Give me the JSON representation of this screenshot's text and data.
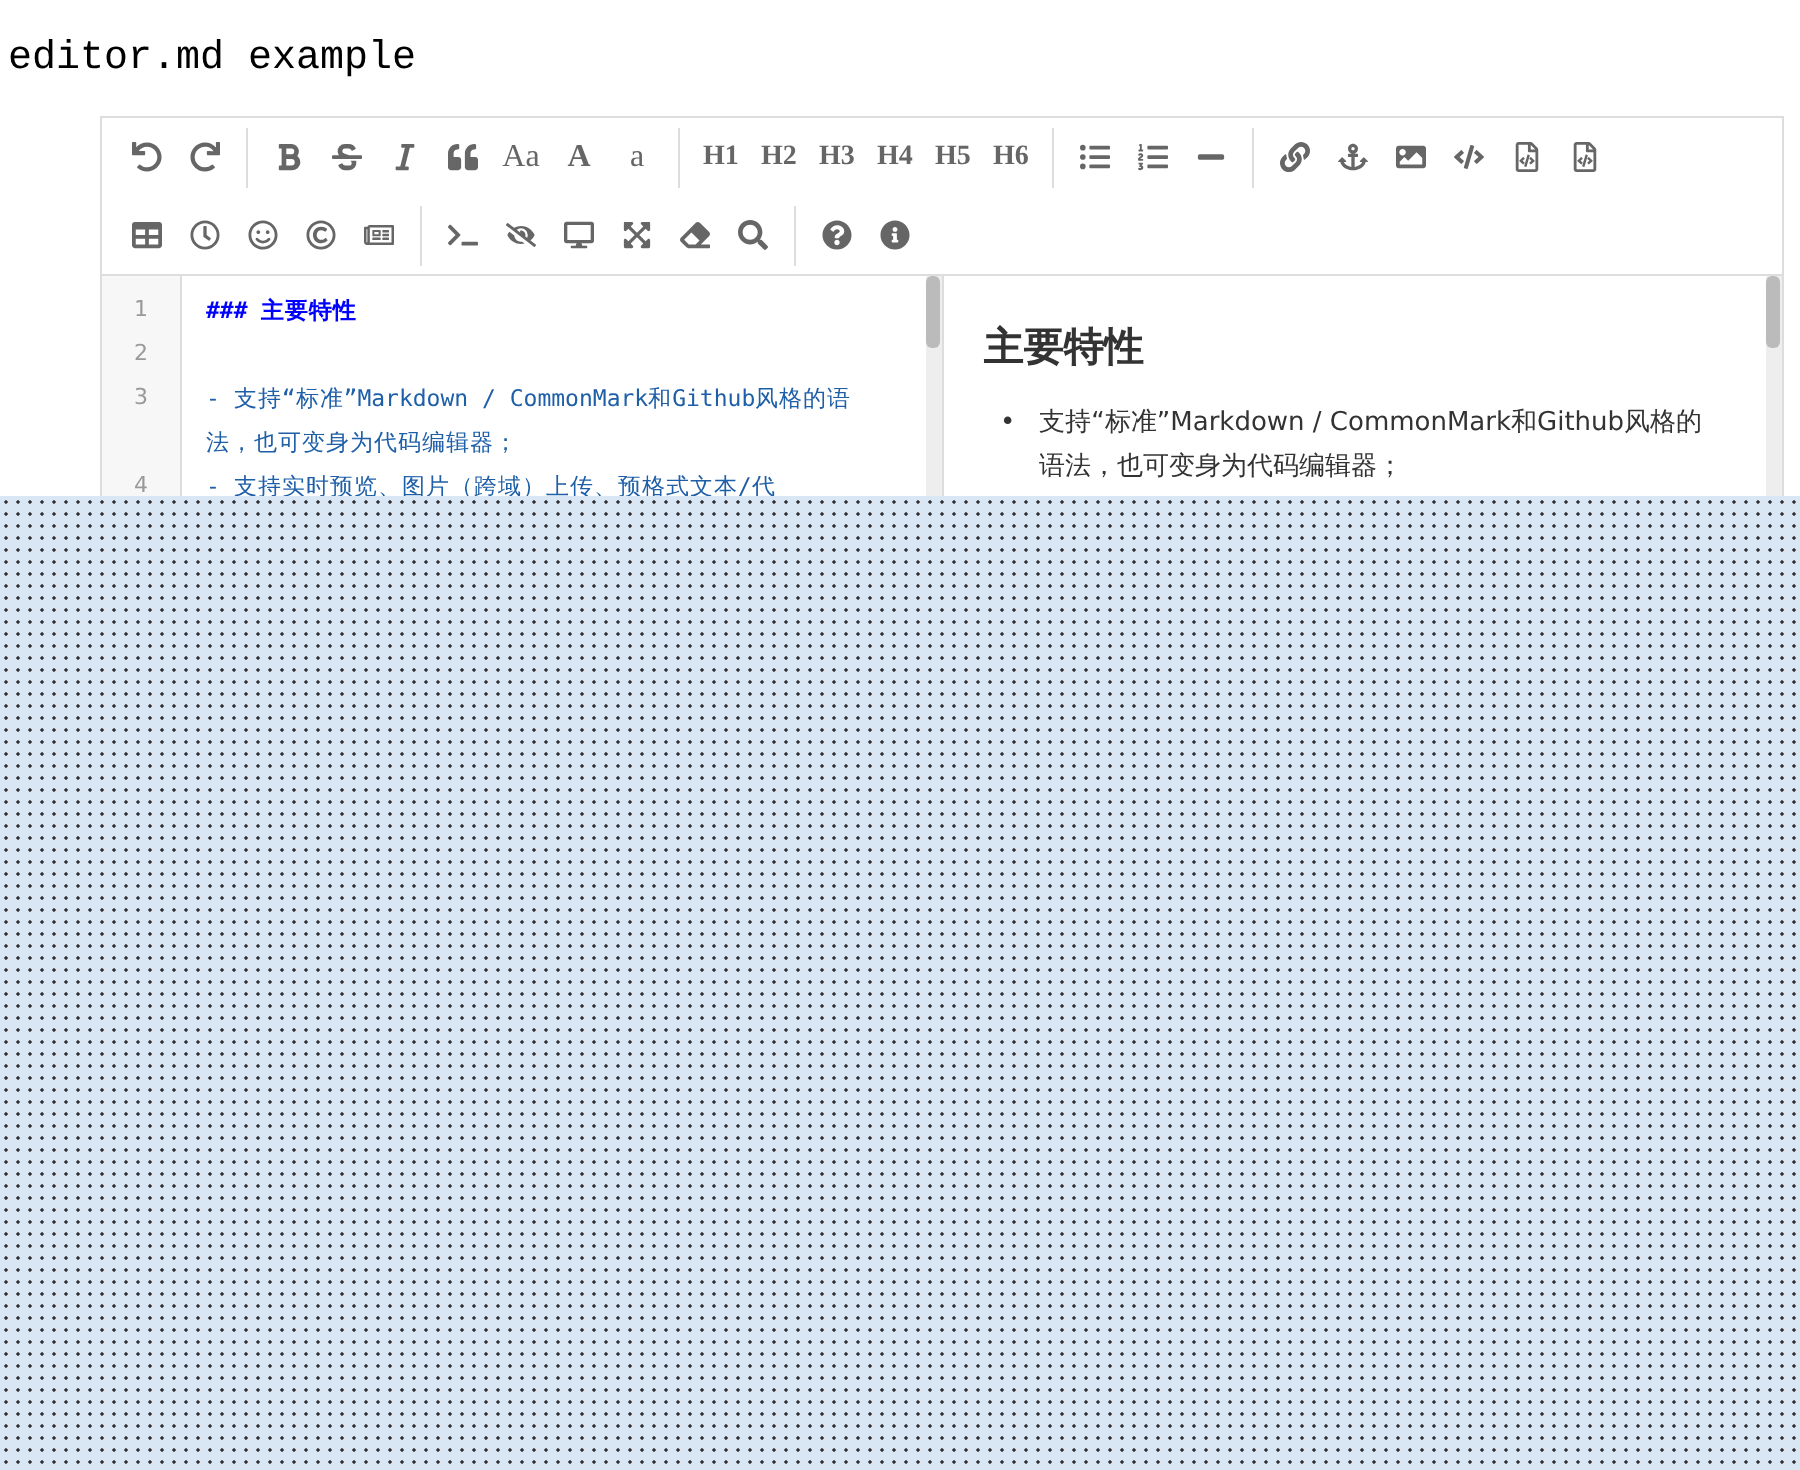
{
  "page_title": "editor.md example",
  "toolbar": {
    "rows": [
      [
        [
          {
            "kind": "icon"
          },
          {
            "kind": "icon"
          }
        ],
        [
          {
            "kind": "icon"
          },
          {
            "kind": "icon"
          },
          {
            "kind": "icon"
          },
          {
            "kind": "icon"
          },
          {
            "kind": "text",
            "label": "Aa"
          },
          {
            "kind": "bold_text",
            "label": "A"
          },
          {
            "kind": "text",
            "label": "a"
          }
        ],
        [
          {
            "kind": "text",
            "label": "H1"
          },
          {
            "kind": "text",
            "label": "H2"
          },
          {
            "kind": "text",
            "label": "H3"
          },
          {
            "kind": "text",
            "label": "H4"
          },
          {
            "kind": "text",
            "label": "H5"
          },
          {
            "kind": "text",
            "label": "H6"
          }
        ],
        [
          {
            "kind": "icon"
          },
          {
            "kind": "icon"
          },
          {
            "kind": "icon"
          }
        ],
        [
          {
            "kind": "icon"
          },
          {
            "kind": "icon"
          },
          {
            "kind": "icon"
          },
          {
            "kind": "icon"
          },
          {
            "kind": "icon"
          },
          {
            "kind": "icon"
          }
        ]
      ],
      [
        [
          {
            "kind": "icon"
          },
          {
            "kind": "icon"
          },
          {
            "kind": "icon"
          },
          {
            "kind": "icon"
          },
          {
            "kind": "icon"
          }
        ],
        [
          {
            "kind": "icon"
          },
          {
            "kind": "icon"
          },
          {
            "kind": "icon"
          },
          {
            "kind": "icon"
          },
          {
            "kind": "icon"
          },
          {
            "kind": "icon"
          }
        ],
        [
          {
            "kind": "icon"
          },
          {
            "kind": "icon"
          }
        ]
      ]
    ]
  },
  "code_lines": [
    {
      "number": "1",
      "kind": "heading",
      "text": "### 主要特性"
    },
    {
      "number": "2",
      "kind": "blank"
    },
    {
      "number": "3",
      "kind": "list",
      "text": "- 支持“标准”Markdown / CommonMark和Github风格的语法，也可变身为代码编辑器；"
    },
    {
      "number": "4",
      "kind": "list",
      "text": "- 支持实时预览、图片（跨域）上传、预格式文本/代"
    }
  ],
  "preview": {
    "heading": "主要特性",
    "items": [
      {
        "bullet": "•",
        "text": "支持“标准”Markdown / CommonMark和Github风格的语法，也可变身为代码编辑器；"
      }
    ]
  }
}
